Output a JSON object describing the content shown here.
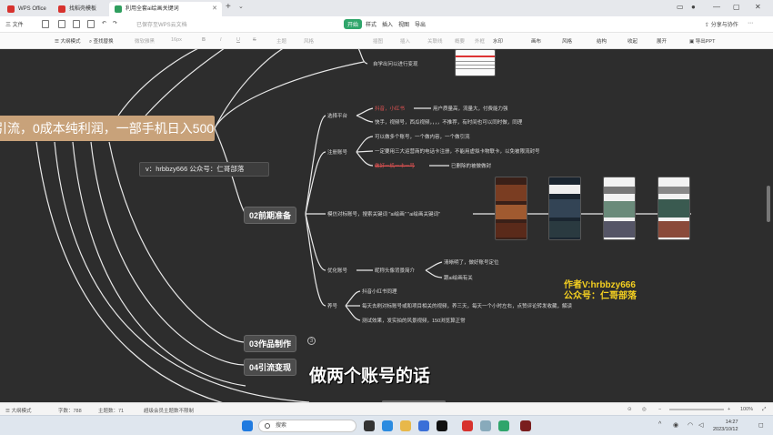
{
  "tabs": [
    {
      "label": "WPS Office",
      "color": "#d7322e"
    },
    {
      "label": "找稻壳模板",
      "color": "#d7322e"
    },
    {
      "label": "利用全套ai绘画关键词",
      "color": "#2f9e5e"
    }
  ],
  "menubar": {
    "file": "三 文件",
    "saved_note": "已保存至WPS云文档",
    "tabs": [
      "开始",
      "样式",
      "插入",
      "视图",
      "导出"
    ],
    "share": "分享与协作"
  },
  "toolbar": {
    "items": [
      "大纲模式",
      "查找替换",
      "微软雅黑",
      "16px",
      "B",
      "I",
      "U",
      "S",
      "主题",
      "风格",
      "插图",
      "插入",
      "关联线",
      "概要",
      "外框",
      "水印",
      "画布",
      "风格",
      "结构",
      "收起",
      "展开",
      "导出PPT"
    ],
    "highlighted": "查找替换"
  },
  "mindmap": {
    "root": "引流，0成本纯利润，一部手机日入500+",
    "wechat": "v：hrbbzy666 公众号：仁哥部落",
    "top_note": "自学出问以进行变现",
    "branch_main": "02前期准备",
    "branch3": "03作品制作",
    "branch3_badge": "3",
    "branch4": "04引流变现",
    "sections": {
      "platform": "选择平台",
      "register": "注册账号",
      "benchmark": "模仿对标账号，搜索关键词 \"ai绘画\"  \"ai绘画关键词\"",
      "optimize": "优化账号",
      "nurture": "养号"
    },
    "platform_items": [
      {
        "text": "抖音，小红书",
        "red": true
      },
      {
        "text": "用户质量高，流量大，付费能力强",
        "red": false
      },
      {
        "text": "快手，视频号，西瓜视频，，，，不推荐，有时间也可以同时做，同理",
        "red": false
      }
    ],
    "register_items": [
      {
        "text": "可以做多个账号，一个做内容，一个做引流",
        "red": false
      },
      {
        "text": "一定要用三大运营商的电话卡注册，不能用虚拟卡物联卡，以免被限流封号",
        "red": false
      },
      {
        "text": "做好一机一卡一号",
        "red": true
      },
      {
        "text": "已删除的被做做封",
        "red": false
      }
    ],
    "optimize_items": [
      {
        "text": "昵称头像背景简介",
        "red": false
      },
      {
        "text": "清晰明了，做好账号定位",
        "red": false
      },
      {
        "text": "跟ai绘画有关",
        "red": false
      }
    ],
    "nurture_items": [
      {
        "text": "抖音小红书同理",
        "red": false
      },
      {
        "text": "每天去刷对标账号或和项目相关的视频，养三天，每天一个小时左右，点赞评论转发收藏，解读",
        "red": false
      },
      {
        "text": "测试效果，发实拍的风景视频，150浏览算正常",
        "red": false
      }
    ]
  },
  "watermark": {
    "line1": "作者V:hrbbzy666",
    "line2": "公众号：仁哥部落"
  },
  "subtitle": "做两个账号的话",
  "statusbar": {
    "mode": "大纲模式",
    "words_label": "字数：788",
    "topics_label": "主题数：71",
    "vip_note": "超级会员主题数不限制",
    "zoom": "100%"
  },
  "taskbar": {
    "search_placeholder": "搜索",
    "time": "14:27",
    "date": "2023/10/12"
  },
  "colors": {
    "canvas": "#2d2d2d",
    "root": "#c8a27a",
    "accent_green": "#2fa56b",
    "red_text": "#e05252",
    "watermark": "#f5d020"
  }
}
